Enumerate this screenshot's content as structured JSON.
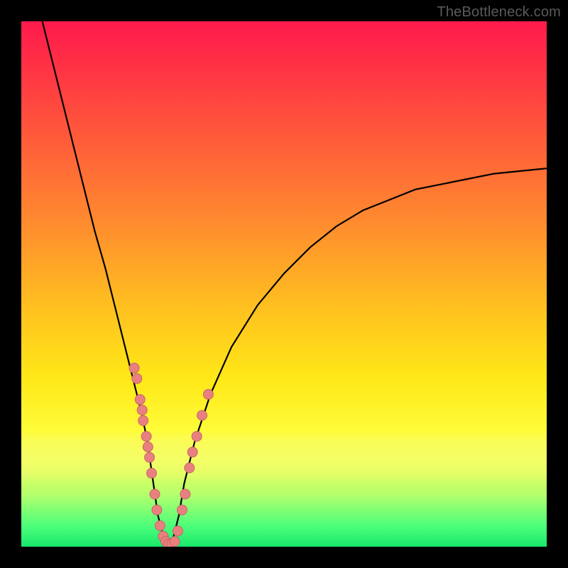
{
  "watermark": "TheBottleneck.com",
  "colors": {
    "dot_fill": "#e98080",
    "dot_stroke": "#c96565",
    "curve": "#000000"
  },
  "chart_data": {
    "type": "line",
    "title": "",
    "xlabel": "",
    "ylabel": "",
    "xlim": [
      0,
      100
    ],
    "ylim": [
      0,
      100
    ],
    "grid": false,
    "series": [
      {
        "name": "bottleneck-curve",
        "x": [
          4,
          6,
          8,
          10,
          12,
          14,
          16,
          18,
          20,
          22,
          23,
          24,
          25,
          26,
          27,
          28,
          29,
          30,
          31,
          33,
          36,
          40,
          45,
          50,
          55,
          60,
          65,
          70,
          75,
          80,
          85,
          90,
          95,
          100
        ],
        "y": [
          100,
          92,
          84,
          76,
          68,
          60,
          53,
          45,
          37,
          29,
          25,
          20,
          13,
          6,
          2,
          0,
          2,
          6,
          12,
          20,
          29,
          38,
          46,
          52,
          57,
          61,
          64,
          66,
          68,
          69,
          70,
          71,
          71.5,
          72
        ]
      }
    ],
    "points": [
      {
        "x": 21.5,
        "y": 34
      },
      {
        "x": 22.0,
        "y": 32
      },
      {
        "x": 22.6,
        "y": 28
      },
      {
        "x": 23.0,
        "y": 26
      },
      {
        "x": 23.2,
        "y": 24
      },
      {
        "x": 23.8,
        "y": 21
      },
      {
        "x": 24.1,
        "y": 19
      },
      {
        "x": 24.4,
        "y": 17
      },
      {
        "x": 24.8,
        "y": 14
      },
      {
        "x": 25.4,
        "y": 10
      },
      {
        "x": 25.8,
        "y": 7
      },
      {
        "x": 26.4,
        "y": 4
      },
      {
        "x": 27.0,
        "y": 2
      },
      {
        "x": 27.5,
        "y": 1
      },
      {
        "x": 28.0,
        "y": 0.5
      },
      {
        "x": 28.6,
        "y": 0.5
      },
      {
        "x": 29.2,
        "y": 1
      },
      {
        "x": 29.8,
        "y": 3
      },
      {
        "x": 30.6,
        "y": 7
      },
      {
        "x": 31.2,
        "y": 10
      },
      {
        "x": 32.0,
        "y": 15
      },
      {
        "x": 32.6,
        "y": 18
      },
      {
        "x": 33.4,
        "y": 21
      },
      {
        "x": 34.4,
        "y": 25
      },
      {
        "x": 35.6,
        "y": 29
      }
    ]
  }
}
